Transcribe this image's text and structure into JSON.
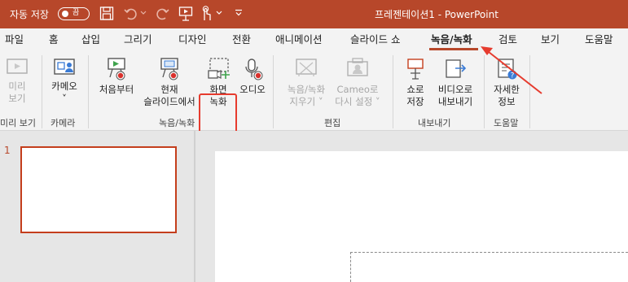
{
  "titlebar": {
    "autosave_label": "자동 저장",
    "toggle_state": "끔",
    "doc_title": "프레젠테이션1  -  PowerPoint"
  },
  "tabs": [
    "파일",
    "홈",
    "삽입",
    "그리기",
    "디자인",
    "전환",
    "애니메이션",
    "슬라이드 쇼",
    "녹음/녹화",
    "검토",
    "보기",
    "도움말"
  ],
  "active_tab": "녹음/녹화",
  "ribbon": {
    "buttons": {
      "preview": [
        "미리",
        "보기"
      ],
      "camera": [
        "카메오",
        "˅"
      ],
      "from_start": "처음부터",
      "from_current": [
        "현재",
        "슬라이드에서"
      ],
      "screen_recording": [
        "화면",
        "녹화"
      ],
      "audio": "오디오",
      "clear_recording": [
        "녹음/녹화",
        "지우기 ˅"
      ],
      "cameo_reset": [
        "Cameo로",
        "다시 설정 ˅"
      ],
      "export_show": [
        "쇼로",
        "저장"
      ],
      "export_video": [
        "비디오로",
        "내보내기"
      ],
      "more_info": [
        "자세한",
        "정보"
      ]
    },
    "groups": {
      "preview": "미리 보기",
      "camera": "카메라",
      "record": "녹음/녹화",
      "edit": "편집",
      "export": "내보내기",
      "help": "도움말"
    }
  },
  "slides": {
    "thumb_number": "1"
  },
  "colors": {
    "brand": "#b7472a",
    "highlight": "#e63b2e"
  }
}
